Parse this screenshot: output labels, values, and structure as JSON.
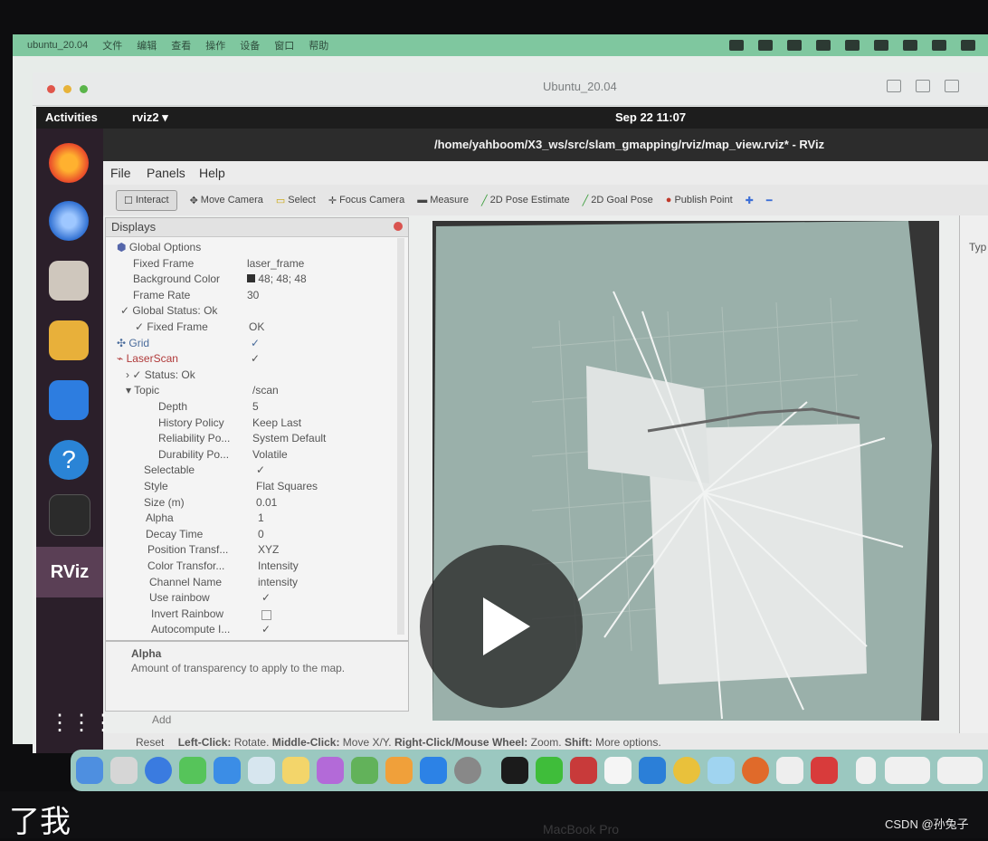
{
  "mac_menubar": {
    "app": "ubuntu_20.04",
    "items": [
      "文件",
      "编辑",
      "查看",
      "操作",
      "设备",
      "窗口",
      "帮助"
    ]
  },
  "vm": {
    "title": "Ubuntu_20.04"
  },
  "ubuntu_topbar": {
    "activities": "Activities",
    "app_menu": "rviz2 ▾",
    "clock": "Sep 22  11:07"
  },
  "rviz": {
    "window_title": "/home/yahboom/X3_ws/src/slam_gmapping/rviz/map_view.rviz* - RViz",
    "menu": [
      "File",
      "Panels",
      "Help"
    ],
    "toolbar": [
      "Interact",
      "Move Camera",
      "Select",
      "Focus Camera",
      "Measure",
      "2D Pose Estimate",
      "2D Goal Pose",
      "Publish Point"
    ],
    "displays_title": "Displays",
    "rows": [
      {
        "name": "Global Options",
        "value": ""
      },
      {
        "name": "Fixed Frame",
        "value": "laser_frame"
      },
      {
        "name": "Background Color",
        "value": "48; 48; 48"
      },
      {
        "name": "Frame Rate",
        "value": "30"
      },
      {
        "name": "✓ Global Status: Ok",
        "value": ""
      },
      {
        "name": "✓ Fixed Frame",
        "value": "OK"
      },
      {
        "name": "Grid",
        "value": "✓"
      },
      {
        "name": "LaserScan",
        "value": "✓"
      },
      {
        "name": "› ✓ Status: Ok",
        "value": ""
      },
      {
        "name": "▾ Topic",
        "value": "/scan"
      },
      {
        "name": "Depth",
        "value": "5"
      },
      {
        "name": "History Policy",
        "value": "Keep Last"
      },
      {
        "name": "Reliability Po...",
        "value": "System Default"
      },
      {
        "name": "Durability Po...",
        "value": "Volatile"
      },
      {
        "name": "Selectable",
        "value": "✓"
      },
      {
        "name": "Style",
        "value": "Flat Squares"
      },
      {
        "name": "Size (m)",
        "value": "0.01"
      },
      {
        "name": "Alpha",
        "value": "1"
      },
      {
        "name": "Decay Time",
        "value": "0"
      },
      {
        "name": "Position Transf...",
        "value": "XYZ"
      },
      {
        "name": "Color Transfor...",
        "value": "Intensity"
      },
      {
        "name": "Channel Name",
        "value": "intensity"
      },
      {
        "name": "Use rainbow",
        "value": "✓"
      },
      {
        "name": "Invert Rainbow",
        "value": ""
      },
      {
        "name": "Autocompute I...",
        "value": "✓"
      }
    ],
    "desc_title": "Alpha",
    "desc_text": "Amount of transparency to apply to the map.",
    "add_button": "Add",
    "reset_button": "Reset",
    "status": {
      "left_click": "Left-Click:",
      "left_click_action": "Rotate.",
      "middle_click": "Middle-Click:",
      "middle_click_action": "Move X/Y.",
      "right_click": "Right-Click/Mouse Wheel:",
      "right_click_action": "Zoom.",
      "shift": "Shift:",
      "shift_action": "More options."
    },
    "right_panel_label": "Typ"
  },
  "subtitle": "了我",
  "bezel_label": "MacBook Pro",
  "watermark": "CSDN @孙兔子",
  "colors": {
    "mac_menubar": "#7fc79f",
    "dock_bg": "#2b1f2a",
    "viewport_map": "#9fb3ad",
    "laser_red": "#c0392b"
  }
}
